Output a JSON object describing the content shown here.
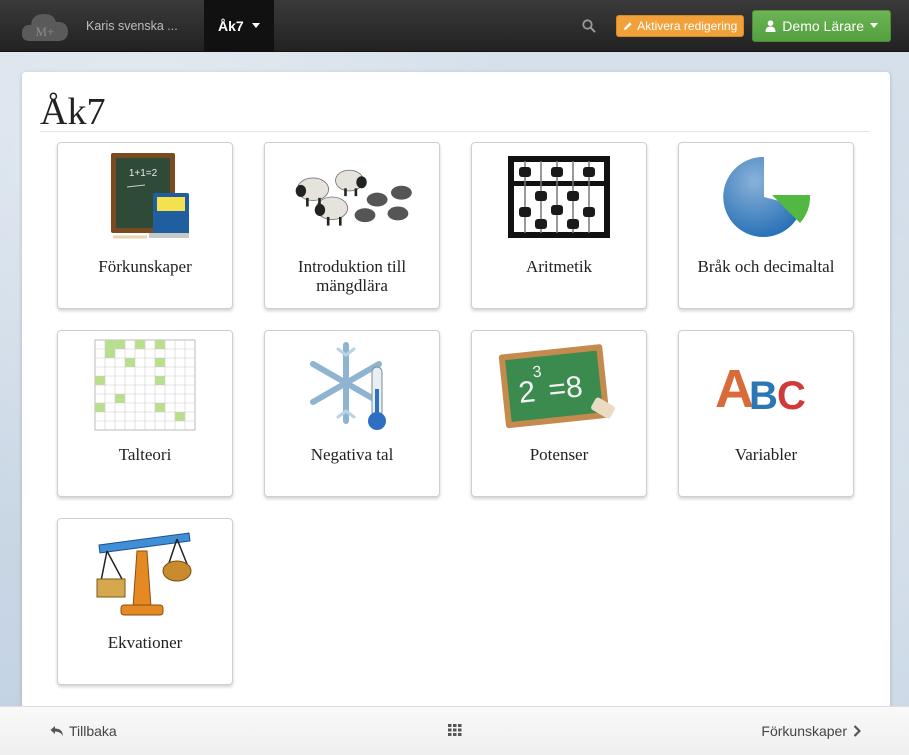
{
  "navbar": {
    "logo_text": "M+",
    "site_name": "Karis svenska ...",
    "course_menu_label": "Åk7",
    "edit_label": "Aktivera redigering",
    "user_label": "Demo Lärare"
  },
  "page": {
    "title": "Åk7"
  },
  "tiles": [
    {
      "label": "Förkunskaper",
      "icon": "chalkboard-books-icon"
    },
    {
      "label": "Introduktion till mängdlära",
      "icon": "sheep-and-stones-icon"
    },
    {
      "label": "Aritmetik",
      "icon": "abacus-icon"
    },
    {
      "label": "Bråk och decimaltal",
      "icon": "pie-chart-icon"
    },
    {
      "label": "Talteori",
      "icon": "number-grid-icon"
    },
    {
      "label": "Negativa tal",
      "icon": "snowflake-thermometer-icon"
    },
    {
      "label": "Potenser",
      "icon": "chalkboard-power-icon"
    },
    {
      "label": "Variabler",
      "icon": "abc-letters-icon"
    },
    {
      "label": "Ekvationer",
      "icon": "balance-scale-icon"
    }
  ],
  "picture_text": {
    "chalkboard": "1+1=2",
    "power": "2",
    "power_exp": "3",
    "power_result": "=8",
    "abc_a": "A",
    "abc_b": "B",
    "abc_c": "C"
  },
  "footer": {
    "back_label": "Tillbaka",
    "next_label": "Förkunskaper"
  },
  "colors": {
    "navbar": "#222222",
    "edit_button": "#f0a13a",
    "user_button": "#5cb85c"
  }
}
